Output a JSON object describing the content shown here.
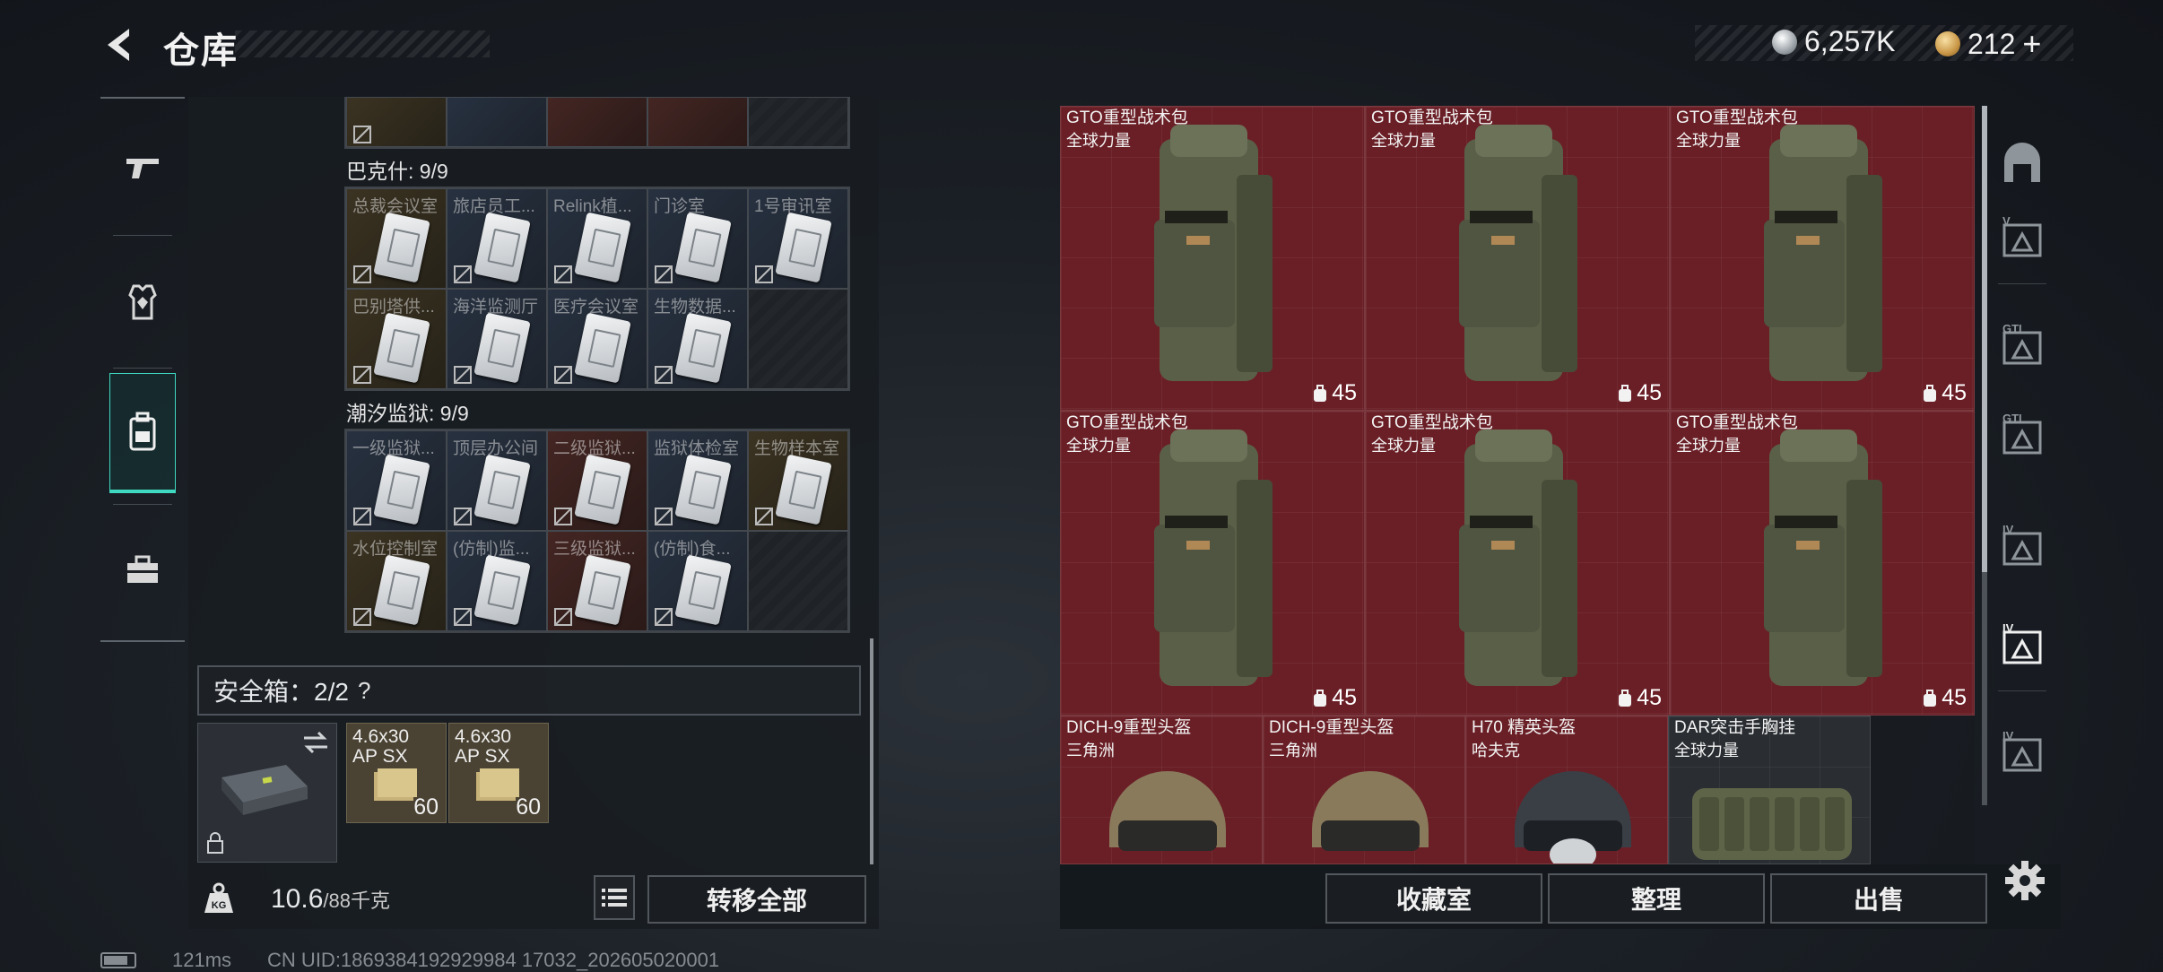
{
  "header": {
    "title": "仓库",
    "currency": [
      {
        "name": "silver-coin",
        "value": "6,257K"
      },
      {
        "name": "gold-coin",
        "value": "212",
        "suffix": "+"
      }
    ]
  },
  "leftnav": {
    "items": [
      {
        "icon": "pistol-icon"
      },
      {
        "icon": "armor-icon"
      },
      {
        "icon": "backpack-icon",
        "active": true
      },
      {
        "icon": "toolbox-icon"
      }
    ]
  },
  "stash": {
    "groups": [
      {
        "label": "巴克什: 9/9",
        "cells": [
          {
            "label": "总裁会议室",
            "tint": "gold"
          },
          {
            "label": "旅店员工...",
            "tint": "blue"
          },
          {
            "label": "Relink植...",
            "tint": "blue"
          },
          {
            "label": "门诊室",
            "tint": "blue"
          },
          {
            "label": "1号审讯室",
            "tint": "blue"
          },
          {
            "label": "巴别塔供...",
            "tint": "gold"
          },
          {
            "label": "海洋监测厅",
            "tint": "blue"
          },
          {
            "label": "医疗会议室",
            "tint": "blue"
          },
          {
            "label": "生物数据...",
            "tint": "blue"
          },
          {
            "label": "",
            "tint": "empty"
          }
        ]
      },
      {
        "label": "潮汐监狱: 9/9",
        "cells": [
          {
            "label": "一级监狱...",
            "tint": "blue"
          },
          {
            "label": "顶层办公间",
            "tint": "blue"
          },
          {
            "label": "二级监狱...",
            "tint": "red"
          },
          {
            "label": "监狱体检室",
            "tint": "blue"
          },
          {
            "label": "生物样本室",
            "tint": "gold"
          },
          {
            "label": "水位控制室",
            "tint": "gold"
          },
          {
            "label": "(仿制)监...",
            "tint": "blue"
          },
          {
            "label": "三级监狱...",
            "tint": "red"
          },
          {
            "label": "(仿制)食...",
            "tint": "blue"
          },
          {
            "label": "",
            "tint": "empty"
          }
        ]
      }
    ],
    "safe_box": {
      "label": "安全箱：2/2",
      "help": "?",
      "items": [
        {
          "name": "4.6x30",
          "sub": "AP SX",
          "count": "60"
        },
        {
          "name": "4.6x30",
          "sub": "AP SX",
          "count": "60"
        }
      ]
    },
    "weight": {
      "value": "10.6",
      "unit": "/88千克"
    },
    "transfer_all": "转移全部"
  },
  "inventory": {
    "items": [
      {
        "name": "GTO重型战术包",
        "sub": "全球力量",
        "weight": "45",
        "kind": "backpack"
      },
      {
        "name": "GTO重型战术包",
        "sub": "全球力量",
        "weight": "45",
        "kind": "backpack"
      },
      {
        "name": "GTO重型战术包",
        "sub": "全球力量",
        "weight": "45",
        "kind": "backpack"
      },
      {
        "name": "GTO重型战术包",
        "sub": "全球力量",
        "weight": "45",
        "kind": "backpack"
      },
      {
        "name": "GTO重型战术包",
        "sub": "全球力量",
        "weight": "45",
        "kind": "backpack"
      },
      {
        "name": "GTO重型战术包",
        "sub": "全球力量",
        "weight": "45",
        "kind": "backpack"
      },
      {
        "name": "DICH-9重型头盔",
        "sub": "三角洲",
        "kind": "helmet"
      },
      {
        "name": "DICH-9重型头盔",
        "sub": "三角洲",
        "kind": "helmet"
      },
      {
        "name": "H70 精英头盔",
        "sub": "哈夫克",
        "kind": "helmet-dark"
      },
      {
        "name": "DAR突击手胸挂",
        "sub": "全球力量",
        "kind": "vest"
      }
    ],
    "actions": [
      "收藏室",
      "整理",
      "出售"
    ]
  },
  "rightnav": {
    "items": [
      {
        "icon": "vault-icon",
        "label": ""
      },
      {
        "icon": "tier-v-safe-icon",
        "label": "V"
      },
      {
        "icon": "gti-storage-icon",
        "label": "GTI"
      },
      {
        "icon": "gti-triangle-icon",
        "label": "GTI"
      },
      {
        "icon": "tier-iv-triangle-icon",
        "label": "IV"
      },
      {
        "icon": "tier-iv-locked-icon",
        "label": "IV"
      },
      {
        "icon": "tier-iv-crate-icon",
        "label": "IV"
      }
    ]
  },
  "status": {
    "ping": "121ms",
    "uid": "CN UID:1869384192929984 17032_202605020001"
  },
  "colors": {
    "accent": "#3fd8c0",
    "item_red": "#6a1f26",
    "panel": "#181c21"
  }
}
